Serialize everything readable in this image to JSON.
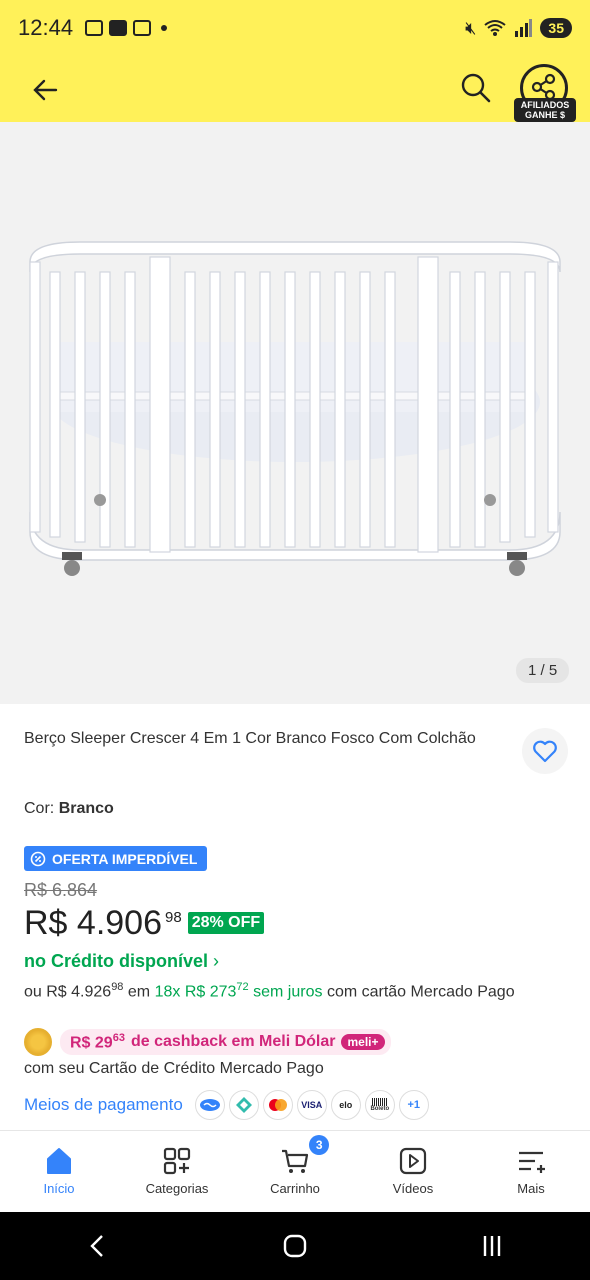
{
  "status": {
    "time": "12:44",
    "battery": "35"
  },
  "header": {
    "share_badge_line1": "AFILIADOS",
    "share_badge_line2": "GANHE $"
  },
  "gallery": {
    "counter": "1 / 5"
  },
  "product": {
    "title": "Berço Sleeper Crescer 4 Em 1 Cor Branco Fosco Com Colchão",
    "color_label": "Cor:",
    "color_value": "Branco",
    "offer_badge": "OFERTA IMPERDÍVEL",
    "old_price": "R$ 6.864",
    "price_int": "R$ 4.906",
    "price_cents": "98",
    "discount": "28% OFF",
    "credit_link": "no Crédito disponível",
    "install_prefix": "ou",
    "install_total": "R$ 4.926",
    "install_total_cents": "98",
    "install_mid": "em",
    "install_count": "18x",
    "install_value": "R$ 273",
    "install_value_cents": "72",
    "install_nofee": "sem juros",
    "install_suffix": "com cartão Mercado Pago",
    "cashback_value": "R$ 29",
    "cashback_cents": "63",
    "cashback_text": "de cashback em Meli Dólar",
    "meli_tag": "meli+",
    "card_text": "com seu Cartão de Crédito Mercado Pago",
    "payment_link": "Meios de pagamento",
    "payment_more": "+1",
    "payment_methods": [
      "mercado-pago",
      "pix",
      "mastercard",
      "visa",
      "elo",
      "boleto"
    ],
    "visa_label": "VISA",
    "elo_label": "elo",
    "boleto_label": "Boleto"
  },
  "nav": {
    "items": [
      {
        "label": "Início",
        "icon": "home-icon"
      },
      {
        "label": "Categorias",
        "icon": "categories-icon"
      },
      {
        "label": "Carrinho",
        "icon": "cart-icon"
      },
      {
        "label": "Vídeos",
        "icon": "video-icon"
      },
      {
        "label": "Mais",
        "icon": "menu-icon"
      }
    ],
    "cart_count": "3"
  },
  "colors": {
    "brand_yellow": "#fff159",
    "accent_blue": "#3483fa",
    "success_green": "#00a650",
    "cashback_pink": "#d1267a"
  }
}
